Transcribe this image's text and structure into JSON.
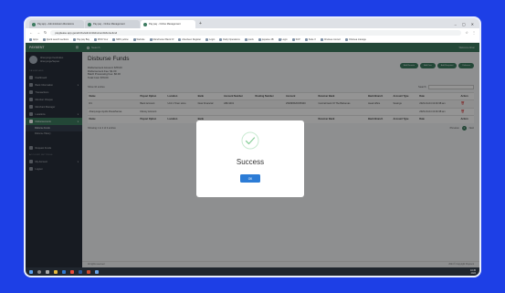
{
  "browser": {
    "tabs": [
      {
        "label": "Pay.app - Administrator Allocations"
      },
      {
        "label": "Pay.pay - Online Management"
      },
      {
        "label": "Pay.pay - Online Management"
      }
    ],
    "url": "payplease.app.genebinfo/admin/disburse/disbursefund",
    "bookmarks": [
      "Apps",
      "Quick search sections",
      "Pay.pay Bay",
      "MSN Your",
      "MRS yellow",
      "Website",
      "Manchester Bank Of",
      "Aberdeen Register",
      "Login",
      "Daily Operations",
      "pools",
      "paywise 4B",
      "Login",
      "SCP",
      "Suite X",
      "Chelsea concert",
      "Chelsea manage"
    ]
  },
  "sidebar": {
    "brand": "PAYMENT",
    "user_name": "Ahanyongo Kendrokus",
    "user_role": "Ahanyonge/Sepsei",
    "dashboard_title": "DASHBOARD",
    "account_title": "ACCOUNT SETTINGS",
    "items": [
      {
        "label": "Dashboard"
      },
      {
        "label": "Bank Information"
      },
      {
        "label": "Transactions"
      },
      {
        "label": "Member Cheque"
      },
      {
        "label": "Merchant Manager"
      },
      {
        "label": "Locations"
      },
      {
        "label": "Disbursements"
      }
    ],
    "subitems": [
      {
        "label": "Disburse Funds"
      },
      {
        "label": "Disburse History"
      }
    ],
    "other_items": [
      {
        "label": "Request Funds"
      }
    ],
    "account_items": [
      {
        "label": "My Account"
      },
      {
        "label": "Logout"
      }
    ]
  },
  "topbar": {
    "search_placeholder": "Search",
    "right_text": "Welcome Ahan"
  },
  "page": {
    "title": "Disburse Funds",
    "stats": [
      "Disbursement Amount: $78.00",
      "Disbursement Fee: $1.00",
      "Batch Processing Fee: $0.00",
      "Total Cost: $79.00"
    ],
    "actions": [
      "Add Remote",
      "Add Few",
      "Add Recipient",
      "Disburse"
    ],
    "show_label": "Show",
    "show_value": "10",
    "entries_label": "entries",
    "search_label": "Search:"
  },
  "table": {
    "headers": [
      "Name",
      "Payout Option",
      "Location",
      "Bank",
      "Account Number",
      "Routing Number",
      "Account",
      "Receiver Bank",
      "Bank Branch",
      "Account Type",
      "Date",
      "Action"
    ],
    "rows": [
      [
        "R1",
        "Bank Account",
        "Unit 1 Town store",
        "Dear Financial",
        "ABC1001",
        "",
        "254896526455300",
        "Central bank Of The Bahamas",
        "Head office",
        "Savings",
        "2023-01-04 13:49:38 am",
        ""
      ],
      [
        "Ahanyonge Ayutlo RouteSense",
        "Disney Account",
        "",
        "",
        "",
        "",
        "",
        "",
        "",
        "",
        "2023-01-04 13:49:38 am",
        ""
      ]
    ],
    "footer_headers": [
      "Name",
      "Payout Option",
      "Location",
      "Bank",
      "",
      "",
      "",
      "Receiver Bank",
      "Bank Branch",
      "Account Type",
      "Date",
      "Action"
    ],
    "showing": "Showing 1 to 2 of 2 entries",
    "prev": "Previous",
    "page": "1",
    "next": "Next"
  },
  "footer": {
    "left": "All rights reserved",
    "right": "2024 © Copyright Payment"
  },
  "modal": {
    "title": "Success",
    "ok_label": "OK"
  },
  "taskbar": {
    "time": "10:45",
    "date": "2024"
  },
  "colors": {
    "brand_green": "#3d7b60",
    "sidebar": "#29303b",
    "background": "#1d3fe6",
    "ok_button": "#2c7cd6",
    "success_check": "#8bcf9b"
  }
}
